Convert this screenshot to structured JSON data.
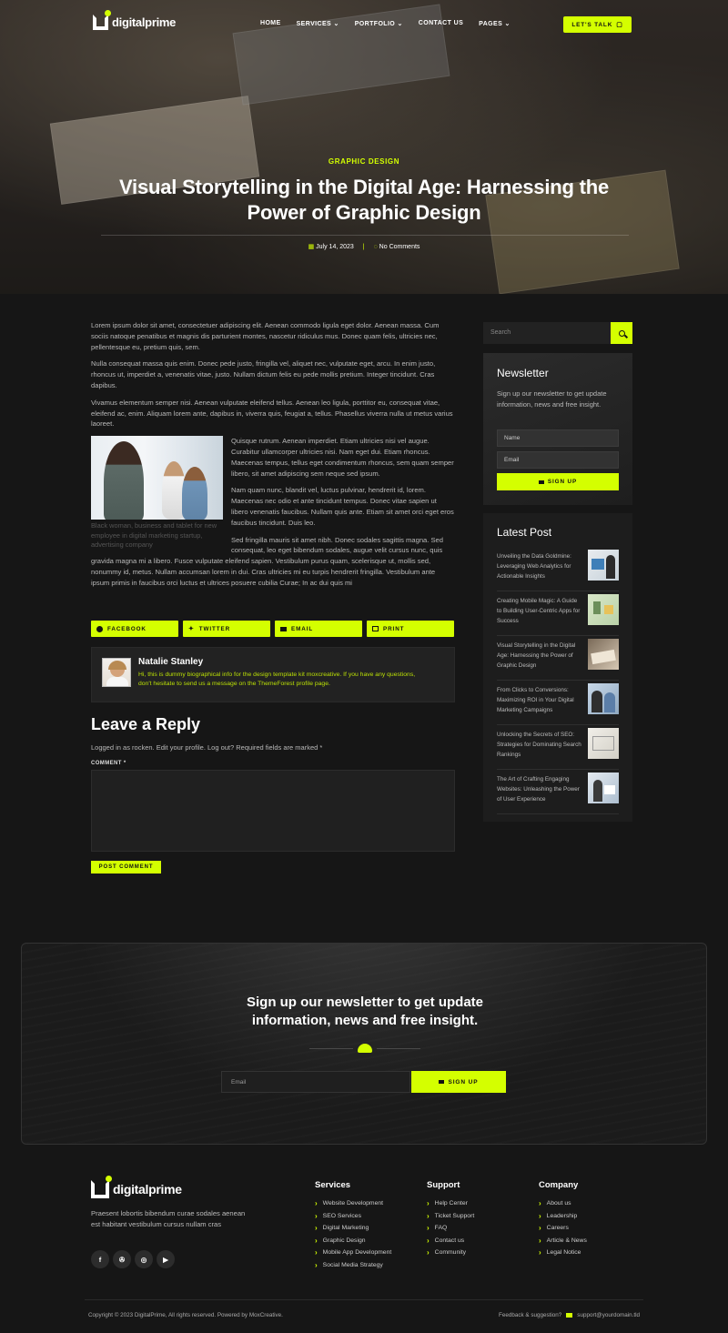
{
  "brand": {
    "name": "digitalprime",
    "accent": "#d4ff00",
    "background": "#161616"
  },
  "nav": {
    "items": [
      {
        "label": "HOME",
        "caret": false
      },
      {
        "label": "SERVICES",
        "caret": true
      },
      {
        "label": "PORTFOLIO",
        "caret": true
      },
      {
        "label": "CONTACT US",
        "caret": false
      },
      {
        "label": "PAGES",
        "caret": true
      }
    ],
    "cta": "LET'S TALK"
  },
  "hero": {
    "category": "GRAPHIC DESIGN",
    "title": "Visual Storytelling in the Digital Age: Harnessing the Power of Graphic Design",
    "date": "July 14, 2023",
    "comments": "No Comments"
  },
  "article": {
    "paragraphs": [
      "Lorem ipsum dolor sit amet, consectetuer adipiscing elit. Aenean commodo ligula eget dolor. Aenean massa. Cum sociis natoque penatibus et magnis dis parturient montes, nascetur ridiculus mus. Donec quam felis, ultricies nec, pellentesque eu, pretium quis, sem.",
      "Nulla consequat massa quis enim. Donec pede justo, fringilla vel, aliquet nec, vulputate eget, arcu. In enim justo, rhoncus ut, imperdiet a, venenatis vitae, justo. Nullam dictum felis eu pede mollis pretium. Integer tincidunt. Cras dapibus.",
      "Vivamus elementum semper nisi. Aenean vulputate eleifend tellus. Aenean leo ligula, porttitor eu, consequat vitae, eleifend ac, enim. Aliquam lorem ante, dapibus in, viverra quis, feugiat a, tellus. Phasellus viverra nulla ut metus varius laoreet.",
      "Quisque rutrum. Aenean imperdiet. Etiam ultricies nisi vel augue. Curabitur ullamcorper ultricies nisi. Nam eget dui. Etiam rhoncus. Maecenas tempus, tellus eget condimentum rhoncus, sem quam semper libero, sit amet adipiscing sem neque sed ipsum.",
      "Nam quam nunc, blandit vel, luctus pulvinar, hendrerit id, lorem. Maecenas nec odio et ante tincidunt tempus. Donec vitae sapien ut libero venenatis faucibus. Nullam quis ante. Etiam sit amet orci eget eros faucibus tincidunt. Duis leo.",
      "Sed fringilla mauris sit amet nibh. Donec sodales sagittis magna. Sed consequat, leo eget bibendum sodales, augue velit cursus nunc, quis gravida magna mi a libero. Fusce vulputate eleifend sapien. Vestibulum purus quam, scelerisque ut, mollis sed, nonummy id, metus. Nullam accumsan lorem in dui. Cras ultricies mi eu turpis hendrerit fringilla. Vestibulum ante ipsum primis in faucibus orci luctus et ultrices posuere cubilia Curae; In ac dui quis mi"
    ],
    "figure_caption": "Black woman, business and tablet for new employee in digital marketing startup, advertising company"
  },
  "share": [
    "FACEBOOK",
    "TWITTER",
    "EMAIL",
    "PRINT"
  ],
  "author": {
    "name": "Natalie Stanley",
    "bio": "Hi, this is dummy biographical info for the design template kit moxcreative. If you have any questions, don't hesitate to send us a message on the ThemeForest profile page."
  },
  "reply": {
    "title": "Leave a Reply",
    "note": "Logged in as rocken. Edit your profile. Log out? Required fields are marked *",
    "comment_label": "COMMENT *",
    "submit": "POST COMMENT"
  },
  "sidebar": {
    "search_placeholder": "Search",
    "newsletter": {
      "title": "Newsletter",
      "text": "Sign up our newsletter to get update information, news and free insight.",
      "name_placeholder": "Name",
      "email_placeholder": "Email",
      "button": "SIGN UP"
    },
    "latest": {
      "title": "Latest Post",
      "posts": [
        "Unveiling the Data Goldmine: Leveraging Web Analytics for Actionable Insights",
        "Creating Mobile Magic: A Guide to Building User-Centric Apps for Success",
        "Visual Storytelling in the Digital Age: Harnessing the Power of Graphic Design",
        "From Clicks to Conversions: Maximizing ROI in Your Digital Marketing Campaigns",
        "Unlocking the Secrets of SEO: Strategies for Dominating Search Rankings",
        "The Art of Crafting Engaging Websites: Unleashing the Power of User Experience"
      ]
    }
  },
  "big_newsletter": {
    "title_line1": "Sign up our newsletter to get update",
    "title_line2": "information, news and free insight.",
    "email_placeholder": "Email",
    "button": "SIGN UP"
  },
  "footer": {
    "description": "Praesent lobortis bibendum curae sodales aenean est habitant vestibulum cursus nullam cras",
    "socials": [
      "f",
      "✇",
      "◎",
      "▶"
    ],
    "columns": [
      {
        "title": "Services",
        "items": [
          "Website Development",
          "SEO Services",
          "Digital Marketing",
          "Graphic Design",
          "Mobile App Development",
          "Social Media Strategy"
        ]
      },
      {
        "title": "Support",
        "items": [
          "Help Center",
          "Ticket Support",
          "FAQ",
          "Contact us",
          "Community"
        ]
      },
      {
        "title": "Company",
        "items": [
          "About us",
          "Leadership",
          "Careers",
          "Article & News",
          "Legal Notice"
        ]
      }
    ],
    "copyright": "Copyright © 2023 DigitalPrime, All rights reserved. Powered by MoxCreative.",
    "feedback": "Feedback & suggestion?",
    "email": "support@yourdomain.tld"
  }
}
